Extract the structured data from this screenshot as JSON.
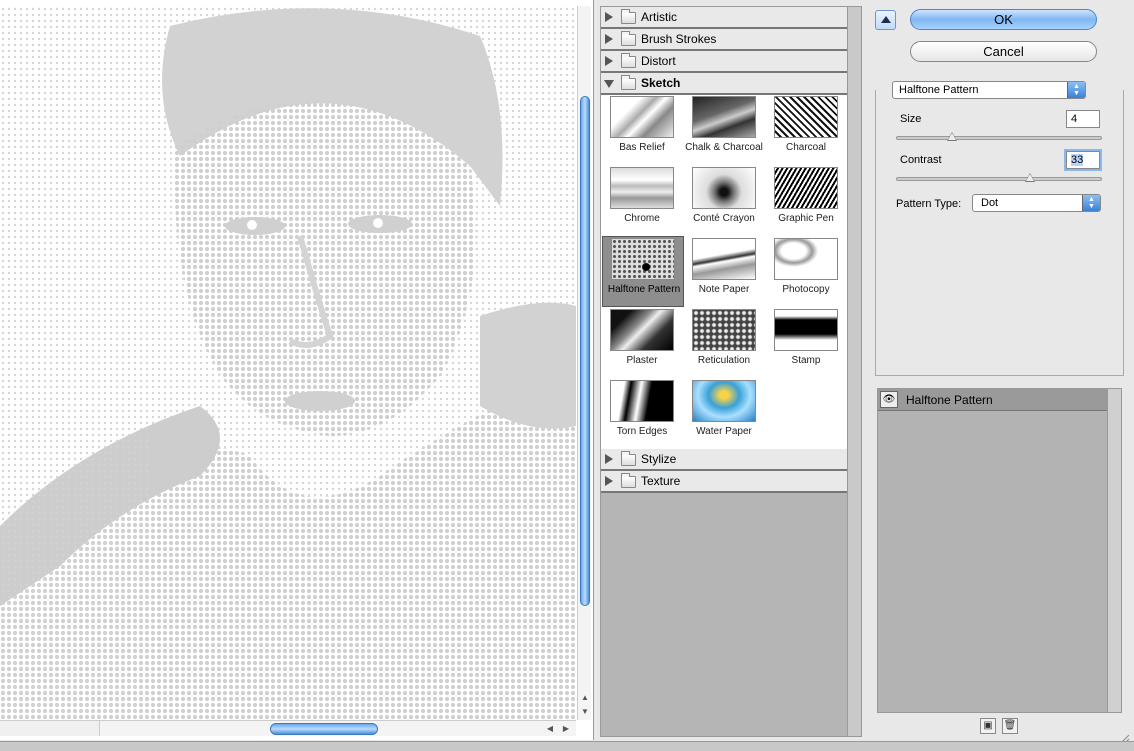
{
  "preview": {},
  "gallery": {
    "categories_top": [
      {
        "label": "Artistic",
        "expanded": false
      },
      {
        "label": "Brush Strokes",
        "expanded": false
      },
      {
        "label": "Distort",
        "expanded": false
      },
      {
        "label": "Sketch",
        "expanded": true
      }
    ],
    "sketch_filters": [
      "Bas Relief",
      "Chalk & Charcoal",
      "Charcoal",
      "Chrome",
      "Conté Crayon",
      "Graphic Pen",
      "Halftone Pattern",
      "Note Paper",
      "Photocopy",
      "Plaster",
      "Reticulation",
      "Stamp",
      "Torn Edges",
      "Water Paper"
    ],
    "selected_filter": "Halftone Pattern",
    "categories_bottom": [
      {
        "label": "Stylize",
        "expanded": false
      },
      {
        "label": "Texture",
        "expanded": false
      }
    ]
  },
  "buttons": {
    "ok_label": "OK",
    "cancel_label": "Cancel"
  },
  "settings": {
    "filter_select": "Halftone Pattern",
    "size_label": "Size",
    "size_value": "4",
    "size_fraction": 0.27,
    "contrast_label": "Contrast",
    "contrast_value": "33",
    "contrast_fraction": 0.65,
    "pattern_type_label": "Pattern Type:",
    "pattern_type_value": "Dot"
  },
  "layers": {
    "items": [
      {
        "label": "Halftone Pattern",
        "visible": true
      }
    ]
  },
  "colors": {
    "accent": "#7fb6f2",
    "panel": "#b3b3b3",
    "halftone": "#cfcfcf"
  }
}
